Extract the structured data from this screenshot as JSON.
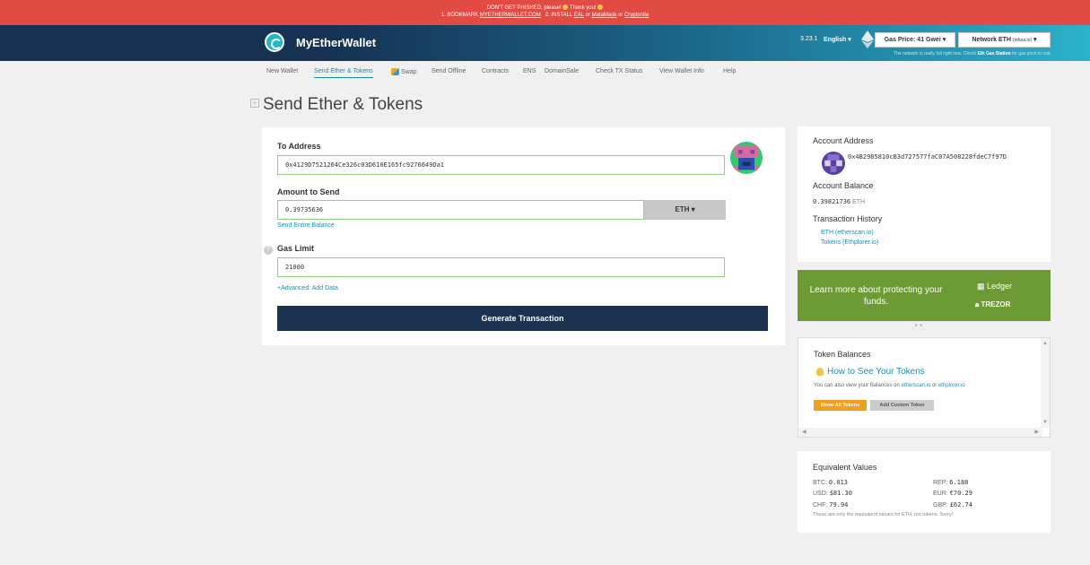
{
  "banner": {
    "line1_a": "DON'T GET PHISHED, please!",
    "line1_b": "Thank you!",
    "line2_prefix": "1. BOOKMARK",
    "bookmark_link": "MYETHERWALLET.COM",
    "line2_mid": "2. INSTALL",
    "eal_link": "EAL",
    "or1": "or",
    "metamask_link": "MetaMask",
    "or2": "or",
    "cryptonite_link": "Cryptonite",
    "color": "#e24b44"
  },
  "header": {
    "app_name": "MyEtherWallet",
    "version": "3.23.1",
    "language": "English",
    "gas_price": "Gas Price: 41 Gwei",
    "network": "Network ETH",
    "network_node": "(infura.io)",
    "network_note_a": "The network is really full right now. Check",
    "network_note_link": "Eth Gas Station",
    "network_note_b": "for gas price to use."
  },
  "nav": {
    "items": [
      "New Wallet",
      "Send Ether & Tokens",
      "Swap",
      "Send Offline",
      "Contracts",
      "ENS",
      "DomainSale",
      "Check TX Status",
      "View Wallet Info",
      "Help"
    ],
    "active": "Send Ether & Tokens"
  },
  "page": {
    "title": "Send Ether & Tokens"
  },
  "form": {
    "to_label": "To Address",
    "to_value": "0x4129D7521264Ce326c03D610E165fc9276649Da1",
    "amount_label": "Amount to Send",
    "amount_value": "0.39735636",
    "unit": "ETH",
    "send_entire": "Send Entire Balance",
    "gas_label": "Gas Limit",
    "gas_value": "21000",
    "advanced": "+Advanced: Add Data",
    "generate": "Generate Transaction"
  },
  "account": {
    "address_label": "Account Address",
    "address": "0x4B2985810cB3d727577faC07A508228fdeC7f97D",
    "balance_label": "Account Balance",
    "balance_value": "0.39821736",
    "balance_unit": "ETH",
    "history_label": "Transaction History",
    "history_eth": "ETH (etherscan.io)",
    "history_tokens": "Tokens (Ethplorer.io)"
  },
  "promo": {
    "text": "Learn more about protecting your funds.",
    "ledger": "Ledger",
    "trezor": "TREZOR",
    "color": "#6c9a34"
  },
  "tokens": {
    "title": "Token Balances",
    "how_to": "How to See Your Tokens",
    "note_a": "You can also view your Balances on",
    "etherscan": "etherscan.io",
    "or": "or",
    "ethplorer": "ethplorer.io",
    "show_all": "Show All Tokens",
    "add_custom": "Add Custom Token"
  },
  "equivalent": {
    "title": "Equivalent Values",
    "btc_label": "BTC:",
    "btc": "0.013",
    "usd_label": "USD:",
    "usd": "$81.30",
    "chf_label": "CHF:",
    "chf": "79.94",
    "rep_label": "REP:",
    "rep": "6.188",
    "eur_label": "EUR:",
    "eur": "€70.29",
    "gbp_label": "GBP:",
    "gbp": "£62.74",
    "note": "These are only the equivalent values for ETH, not tokens. Sorry!"
  }
}
